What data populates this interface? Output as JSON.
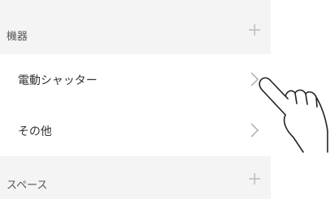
{
  "sections": [
    {
      "label": "機器",
      "action_icon": "plus-icon"
    },
    {
      "label": "スペース",
      "action_icon": "plus-icon"
    }
  ],
  "items": [
    {
      "label": "電動シャッター",
      "icon": "chevron-right-icon"
    },
    {
      "label": "その他",
      "icon": "chevron-right-icon"
    }
  ],
  "overlay_icon": "pointing-hand-icon",
  "colors": {
    "panel_bg": "#f4f4f4",
    "row_bg": "#ffffff",
    "text": "#333333",
    "icon": "#bbbbbb"
  }
}
